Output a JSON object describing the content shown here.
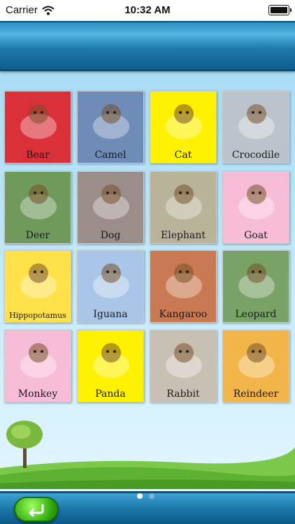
{
  "status_bar": {
    "carrier": "Carrier",
    "time": "10:32 AM",
    "wifi_icon": "wifi-icon",
    "battery_icon": "battery-icon"
  },
  "animals": [
    {
      "label": "Bear",
      "bg": "#d9303a"
    },
    {
      "label": "Camel",
      "bg": "#6f8bb8"
    },
    {
      "label": "Cat",
      "bg": "#fff200"
    },
    {
      "label": "Crocodile",
      "bg": "#bcc3cc"
    },
    {
      "label": "Deer",
      "bg": "#6f9a5c"
    },
    {
      "label": "Dog",
      "bg": "#9a8d8a"
    },
    {
      "label": "Elephant",
      "bg": "#b9b39a"
    },
    {
      "label": "Goat",
      "bg": "#f7bdd7"
    },
    {
      "label": "Hippopotamus",
      "bg": "#ffe14a"
    },
    {
      "label": "Iguana",
      "bg": "#a9c6e8"
    },
    {
      "label": "Kangaroo",
      "bg": "#c97a52"
    },
    {
      "label": "Leopard",
      "bg": "#79a266"
    },
    {
      "label": "Monkey",
      "bg": "#f7bdd7"
    },
    {
      "label": "Panda",
      "bg": "#fff200"
    },
    {
      "label": "Rabbit",
      "bg": "#c9c0b4"
    },
    {
      "label": "Reindeer",
      "bg": "#f2b54a"
    }
  ],
  "pagination": {
    "total": 2,
    "current": 1
  },
  "nav": {
    "back_icon": "back-arrow-icon"
  }
}
